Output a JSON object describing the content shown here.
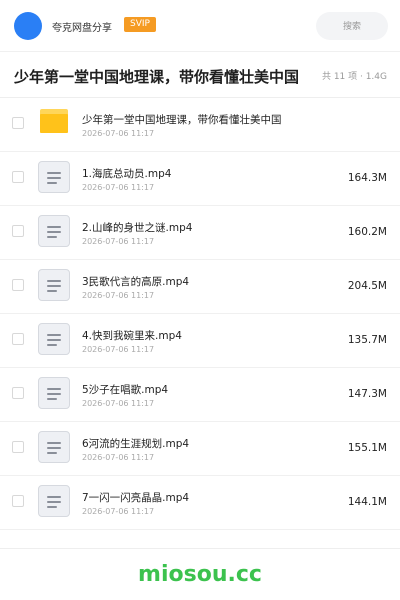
{
  "header": {
    "app_name": "夸克网盘分享",
    "badge": "SVIP",
    "search_placeholder": "搜索"
  },
  "share": {
    "title": "少年第一堂中国地理课，带你看懂壮美中国",
    "summary": "共 11 项 · 1.4G"
  },
  "items": [
    {
      "type": "folder",
      "name": "少年第一堂中国地理课，带你看懂壮美中国",
      "date": "2026-07-06 11:17",
      "size": ""
    },
    {
      "type": "file",
      "name": "1.海底总动员.mp4",
      "date": "2026-07-06 11:17",
      "size": "164.3M"
    },
    {
      "type": "file",
      "name": "2.山峰的身世之谜.mp4",
      "date": "2026-07-06 11:17",
      "size": "160.2M"
    },
    {
      "type": "file",
      "name": "3民歌代言的高原.mp4",
      "date": "2026-07-06 11:17",
      "size": "204.5M"
    },
    {
      "type": "file",
      "name": "4.快到我碗里来.mp4",
      "date": "2026-07-06 11:17",
      "size": "135.7M"
    },
    {
      "type": "file",
      "name": "5沙子在唱歌.mp4",
      "date": "2026-07-06 11:17",
      "size": "147.3M"
    },
    {
      "type": "file",
      "name": "6河流的生涯规划.mp4",
      "date": "2026-07-06 11:17",
      "size": "155.1M"
    },
    {
      "type": "file",
      "name": "7一闪一闪亮晶晶.mp4",
      "date": "2026-07-06 11:17",
      "size": "144.1M"
    }
  ],
  "watermark": "miosou.cc",
  "colors": {
    "avatar": "#2a7ff5",
    "svip_badge": "#f59b23",
    "folder": "#ffc21a",
    "watermark": "#3cc24e"
  }
}
